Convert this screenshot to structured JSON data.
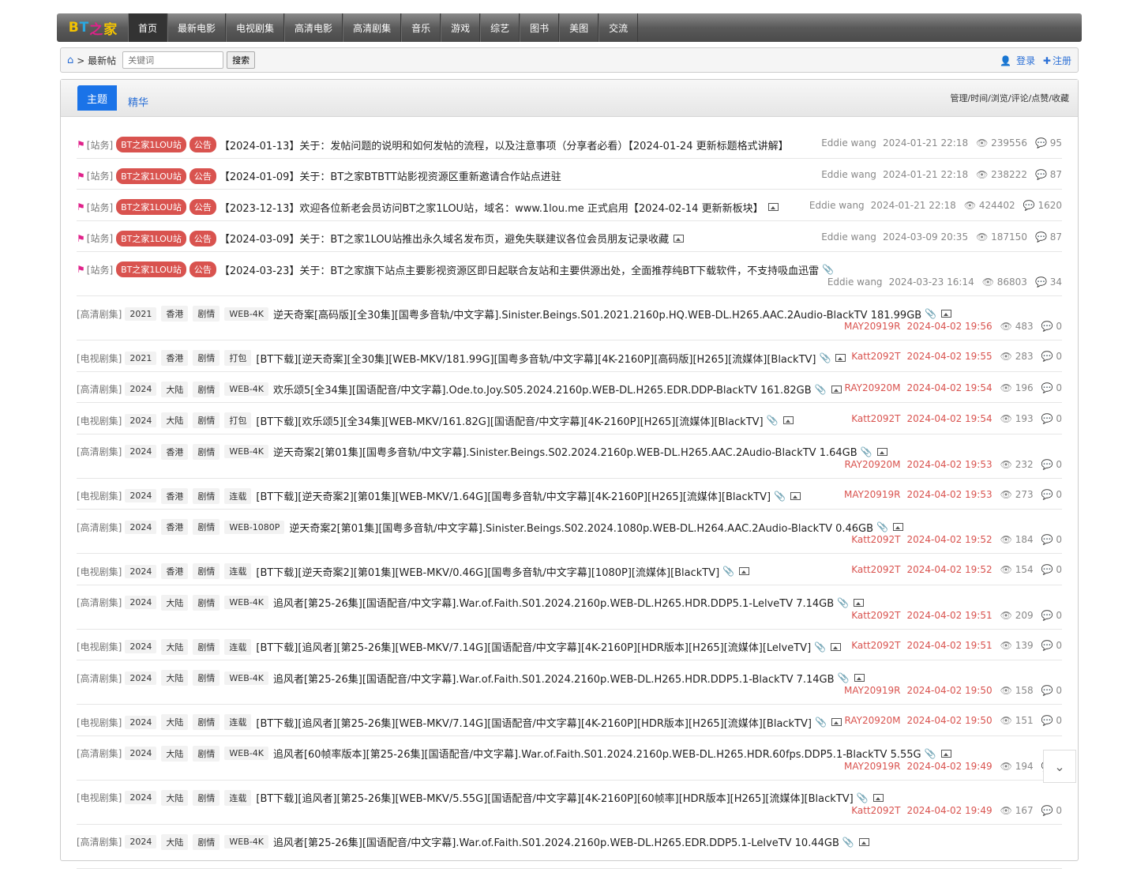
{
  "logo": {
    "text": "BT之家",
    "l1": "B",
    "l2": "T",
    "l3": "之",
    "l4": "家"
  },
  "nav": [
    "首页",
    "最新电影",
    "电视剧集",
    "高清电影",
    "高清剧集",
    "音乐",
    "游戏",
    "综艺",
    "图书",
    "美图",
    "交流"
  ],
  "toolbar": {
    "crumb": "> 最新帖",
    "placeholder": "关键词",
    "search": "搜索",
    "login": "登录",
    "register": "注册"
  },
  "tabs": {
    "main": "主题",
    "jh": "精华"
  },
  "sorter": "管理/时间/浏览/评论/点赞/收藏",
  "notices": [
    {
      "cat": "[站务]",
      "site": "BT之家1LOU站",
      "tag": "公告",
      "title": "【2024-01-13】关于：发帖问题的说明和如何发帖的流程，以及注意事项（分享者必看）【2024-01-24 更新标题格式讲解】",
      "author": "Eddie wang",
      "date": "2024-01-21 22:18",
      "views": "239556",
      "comments": "95"
    },
    {
      "cat": "[站务]",
      "site": "BT之家1LOU站",
      "tag": "公告",
      "title": "【2024-01-09】关于：BT之家BTBTT站影视资源区重新邀请合作站点进驻",
      "author": "Eddie wang",
      "date": "2024-01-21 22:18",
      "views": "238222",
      "comments": "87"
    },
    {
      "cat": "[站务]",
      "site": "BT之家1LOU站",
      "tag": "公告",
      "title": "【2023-12-13】欢迎各位新老会员访问BT之家1LOU站，域名：www.1lou.me 正式启用【2024-02-14 更新新板块】",
      "author": "Eddie wang",
      "date": "2024-01-21 22:18",
      "views": "424402",
      "comments": "1620"
    },
    {
      "cat": "[站务]",
      "site": "BT之家1LOU站",
      "tag": "公告",
      "title": "【2024-03-09】关于：BT之家1LOU站推出永久域名发布页，避免失联建议各位会员朋友记录收藏",
      "author": "Eddie wang",
      "date": "2024-03-09 20:35",
      "views": "187150",
      "comments": "87"
    },
    {
      "cat": "[站务]",
      "site": "BT之家1LOU站",
      "tag": "公告",
      "title": "【2024-03-23】关于：BT之家旗下站点主要影视资源区即日起联合友站和主要供源出处，全面推荐纯BT下载软件，不支持吸血迅雷",
      "author": "Eddie wang",
      "date": "2024-03-23 16:14",
      "views": "86803",
      "comments": "34"
    }
  ],
  "threads": [
    {
      "cat": "[高清剧集]",
      "year": "2021",
      "region": "香港",
      "genre": "剧情",
      "fmt": "WEB-4K",
      "title": "逆天奇案[高码版][全30集][国粤多音轨/中文字幕].Sinister.Beings.S01.2021.2160p.HQ.WEB-DL.H265.AAC.2Audio-BlackTV 181.99GB",
      "author": "MAY20919R",
      "date": "2024-04-02 19:56",
      "views": "483",
      "comments": "0"
    },
    {
      "cat": "[电视剧集]",
      "year": "2021",
      "region": "香港",
      "genre": "剧情",
      "fmt": "打包",
      "title": "[BT下载][逆天奇案][全30集][WEB-MKV/181.99G][国粤多音轨/中文字幕][4K-2160P][高码版][H265][流媒体][BlackTV]",
      "author": "Katt2092T",
      "date": "2024-04-02 19:55",
      "views": "283",
      "comments": "0"
    },
    {
      "cat": "[高清剧集]",
      "year": "2024",
      "region": "大陆",
      "genre": "剧情",
      "fmt": "WEB-4K",
      "title": "欢乐颂5[全34集][国语配音/中文字幕].Ode.to.Joy.S05.2024.2160p.WEB-DL.H265.EDR.DDP-BlackTV 161.82GB",
      "author": "RAY20920M",
      "date": "2024-04-02 19:54",
      "views": "196",
      "comments": "0"
    },
    {
      "cat": "[电视剧集]",
      "year": "2024",
      "region": "大陆",
      "genre": "剧情",
      "fmt": "打包",
      "title": "[BT下载][欢乐颂5][全34集][WEB-MKV/161.82G][国语配音/中文字幕][4K-2160P][H265][流媒体][BlackTV]",
      "author": "Katt2092T",
      "date": "2024-04-02 19:54",
      "views": "193",
      "comments": "0"
    },
    {
      "cat": "[高清剧集]",
      "year": "2024",
      "region": "香港",
      "genre": "剧情",
      "fmt": "WEB-4K",
      "title": "逆天奇案2[第01集][国粤多音轨/中文字幕].Sinister.Beings.S02.2024.2160p.WEB-DL.H265.AAC.2Audio-BlackTV 1.64GB",
      "author": "RAY20920M",
      "date": "2024-04-02 19:53",
      "views": "232",
      "comments": "0"
    },
    {
      "cat": "[电视剧集]",
      "year": "2024",
      "region": "香港",
      "genre": "剧情",
      "fmt": "连载",
      "title": "[BT下载][逆天奇案2][第01集][WEB-MKV/1.64G][国粤多音轨/中文字幕][4K-2160P][H265][流媒体][BlackTV]",
      "author": "MAY20919R",
      "date": "2024-04-02 19:53",
      "views": "273",
      "comments": "0"
    },
    {
      "cat": "[高清剧集]",
      "year": "2024",
      "region": "香港",
      "genre": "剧情",
      "fmt": "WEB-1080P",
      "title": "逆天奇案2[第01集][国粤多音轨/中文字幕].Sinister.Beings.S02.2024.1080p.WEB-DL.H264.AAC.2Audio-BlackTV 0.46GB",
      "author": "Katt2092T",
      "date": "2024-04-02 19:52",
      "views": "184",
      "comments": "0"
    },
    {
      "cat": "[电视剧集]",
      "year": "2024",
      "region": "香港",
      "genre": "剧情",
      "fmt": "连载",
      "title": "[BT下载][逆天奇案2][第01集][WEB-MKV/0.46G][国粤多音轨/中文字幕][1080P][流媒体][BlackTV]",
      "author": "Katt2092T",
      "date": "2024-04-02 19:52",
      "views": "154",
      "comments": "0"
    },
    {
      "cat": "[高清剧集]",
      "year": "2024",
      "region": "大陆",
      "genre": "剧情",
      "fmt": "WEB-4K",
      "title": "追风者[第25-26集][国语配音/中文字幕].War.of.Faith.S01.2024.2160p.WEB-DL.H265.HDR.DDP5.1-LelveTV 7.14GB",
      "author": "Katt2092T",
      "date": "2024-04-02 19:51",
      "views": "209",
      "comments": "0"
    },
    {
      "cat": "[电视剧集]",
      "year": "2024",
      "region": "大陆",
      "genre": "剧情",
      "fmt": "连载",
      "title": "[BT下载][追风者][第25-26集][WEB-MKV/7.14G][国语配音/中文字幕][4K-2160P][HDR版本][H265][流媒体][LelveTV]",
      "author": "Katt2092T",
      "date": "2024-04-02 19:51",
      "views": "139",
      "comments": "0"
    },
    {
      "cat": "[高清剧集]",
      "year": "2024",
      "region": "大陆",
      "genre": "剧情",
      "fmt": "WEB-4K",
      "title": "追风者[第25-26集][国语配音/中文字幕].War.of.Faith.S01.2024.2160p.WEB-DL.H265.HDR.DDP5.1-BlackTV 7.14GB",
      "author": "MAY20919R",
      "date": "2024-04-02 19:50",
      "views": "158",
      "comments": "0"
    },
    {
      "cat": "[电视剧集]",
      "year": "2024",
      "region": "大陆",
      "genre": "剧情",
      "fmt": "连载",
      "title": "[BT下载][追风者][第25-26集][WEB-MKV/7.14G][国语配音/中文字幕][4K-2160P][HDR版本][H265][流媒体][BlackTV]",
      "author": "RAY20920M",
      "date": "2024-04-02 19:50",
      "views": "151",
      "comments": "0"
    },
    {
      "cat": "[高清剧集]",
      "year": "2024",
      "region": "大陆",
      "genre": "剧情",
      "fmt": "WEB-4K",
      "title": "追风者[60帧率版本][第25-26集][国语配音/中文字幕].War.of.Faith.S01.2024.2160p.WEB-DL.H265.HDR.60fps.DDP5.1-BlackTV 5.55G",
      "author": "MAY20919R",
      "date": "2024-04-02 19:49",
      "views": "194",
      "comments": "0"
    },
    {
      "cat": "[电视剧集]",
      "year": "2024",
      "region": "大陆",
      "genre": "剧情",
      "fmt": "连载",
      "title": "[BT下载][追风者][第25-26集][WEB-MKV/5.55G][国语配音/中文字幕][4K-2160P][60帧率][HDR版本][H265][流媒体][BlackTV]",
      "author": "Katt2092T",
      "date": "2024-04-02 19:49",
      "views": "167",
      "comments": "0"
    },
    {
      "cat": "[高清剧集]",
      "year": "2024",
      "region": "大陆",
      "genre": "剧情",
      "fmt": "WEB-4K",
      "title": "追风者[第25-26集][国语配音/中文字幕].War.of.Faith.S01.2024.2160p.WEB-DL.H265.EDR.DDP5.1-LelveTV 10.44GB",
      "author": "",
      "date": "",
      "views": "",
      "comments": ""
    }
  ],
  "layout_hint_rows": [
    "two",
    "one",
    "one",
    "one",
    "two",
    "one",
    "two",
    "one",
    "two",
    "one",
    "two",
    "one",
    "two",
    "two",
    "two"
  ],
  "colors": {
    "accent": "#1a73e8",
    "red": "#d9534f",
    "flag": "#e0218a"
  }
}
